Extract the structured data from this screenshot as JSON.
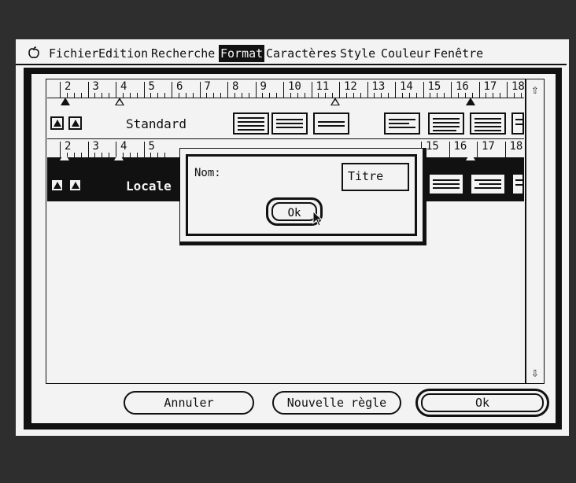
{
  "menubar": {
    "items": [
      "Fichier",
      "Edition",
      "Recherche",
      "Format",
      "Caractères",
      "Style",
      "Couleur",
      "Fenêtre"
    ],
    "active": "Format"
  },
  "ruler_top": [
    "2",
    "3",
    "4",
    "5",
    "6",
    "7",
    "8",
    "9",
    "10",
    "11",
    "12",
    "13",
    "14",
    "15",
    "16",
    "17",
    "18"
  ],
  "ruler_second": [
    "2",
    "3",
    "4",
    "5",
    "15",
    "16",
    "17",
    "18"
  ],
  "styles": {
    "standard_label": "Standard",
    "locale_label": "Locale"
  },
  "dialog": {
    "nom_label": "Nom:",
    "nom_value": "Titre",
    "ok_label": "Ok"
  },
  "buttons": {
    "cancel": "Annuler",
    "new_rule": "Nouvelle règle",
    "ok": "Ok"
  },
  "colors": {
    "foreground": "#111111",
    "background": "#f3f3f3"
  }
}
